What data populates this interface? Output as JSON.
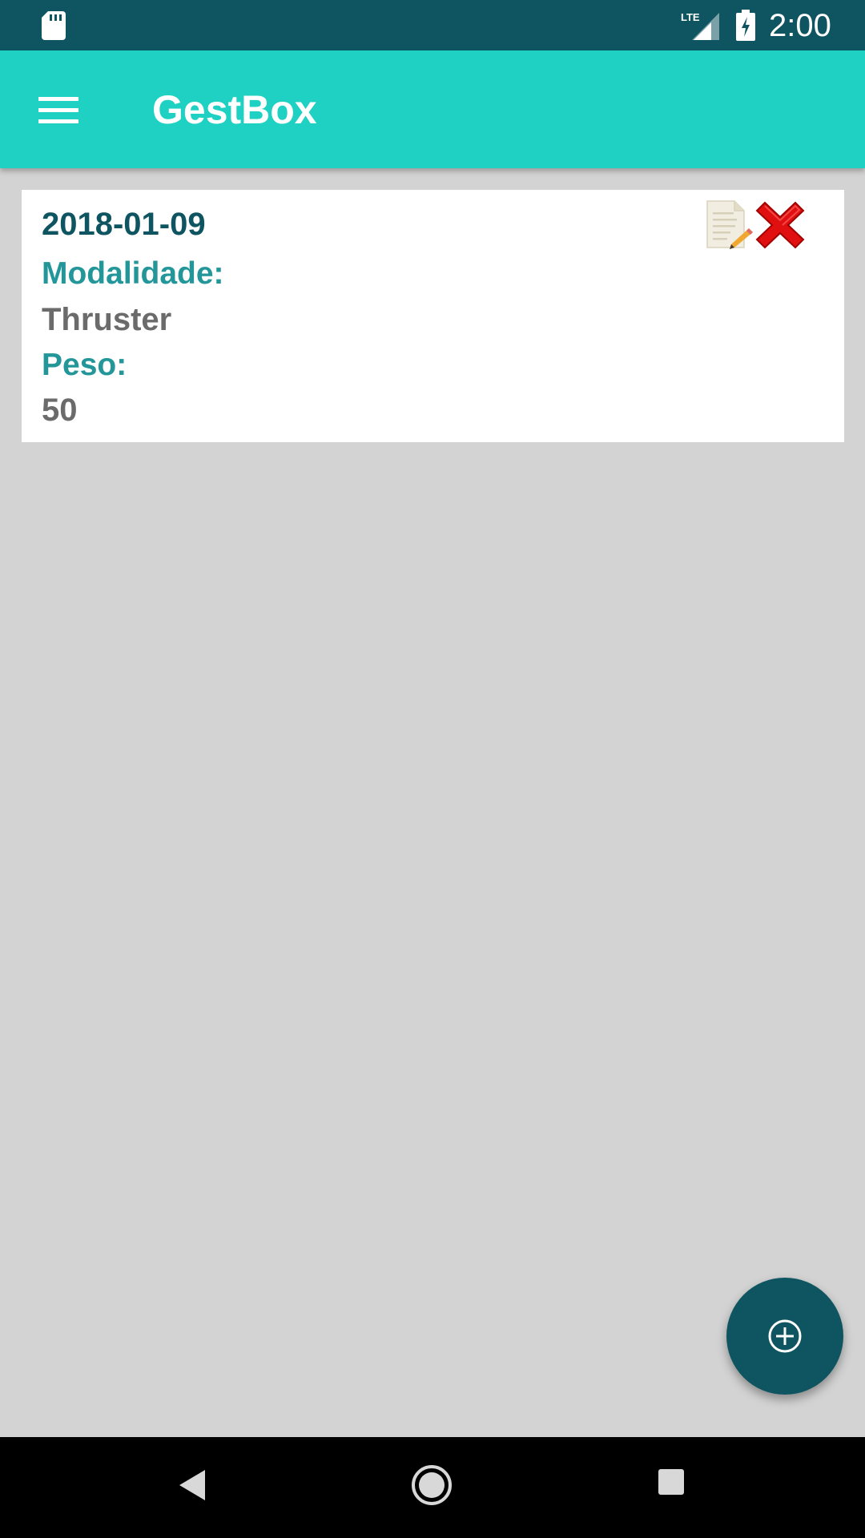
{
  "status_bar": {
    "time": "2:00",
    "network_label": "LTE",
    "icons": [
      "sd-card-icon",
      "lte-signal-icon",
      "battery-charging-icon"
    ]
  },
  "app_bar": {
    "title": "GestBox",
    "menu_icon": "hamburger-menu-icon"
  },
  "records": [
    {
      "date": "2018-01-09",
      "modality_label": "Modalidade:",
      "modality_value": "Thruster",
      "weight_label": "Peso:",
      "weight_value": "50",
      "actions": [
        "edit-icon",
        "delete-icon"
      ]
    }
  ],
  "fab": {
    "icon": "add-circle-icon"
  },
  "nav_bar": {
    "icons": [
      "back-icon",
      "home-icon",
      "recent-apps-icon"
    ]
  },
  "colors": {
    "status_bar": "#0f5561",
    "app_bar": "#1fd1c2",
    "background": "#d3d3d3",
    "date_text": "#0f5561",
    "label_text": "#23969a",
    "value_text": "#6b6b6b",
    "fab": "#0f5561",
    "delete_red": "#e01010"
  }
}
